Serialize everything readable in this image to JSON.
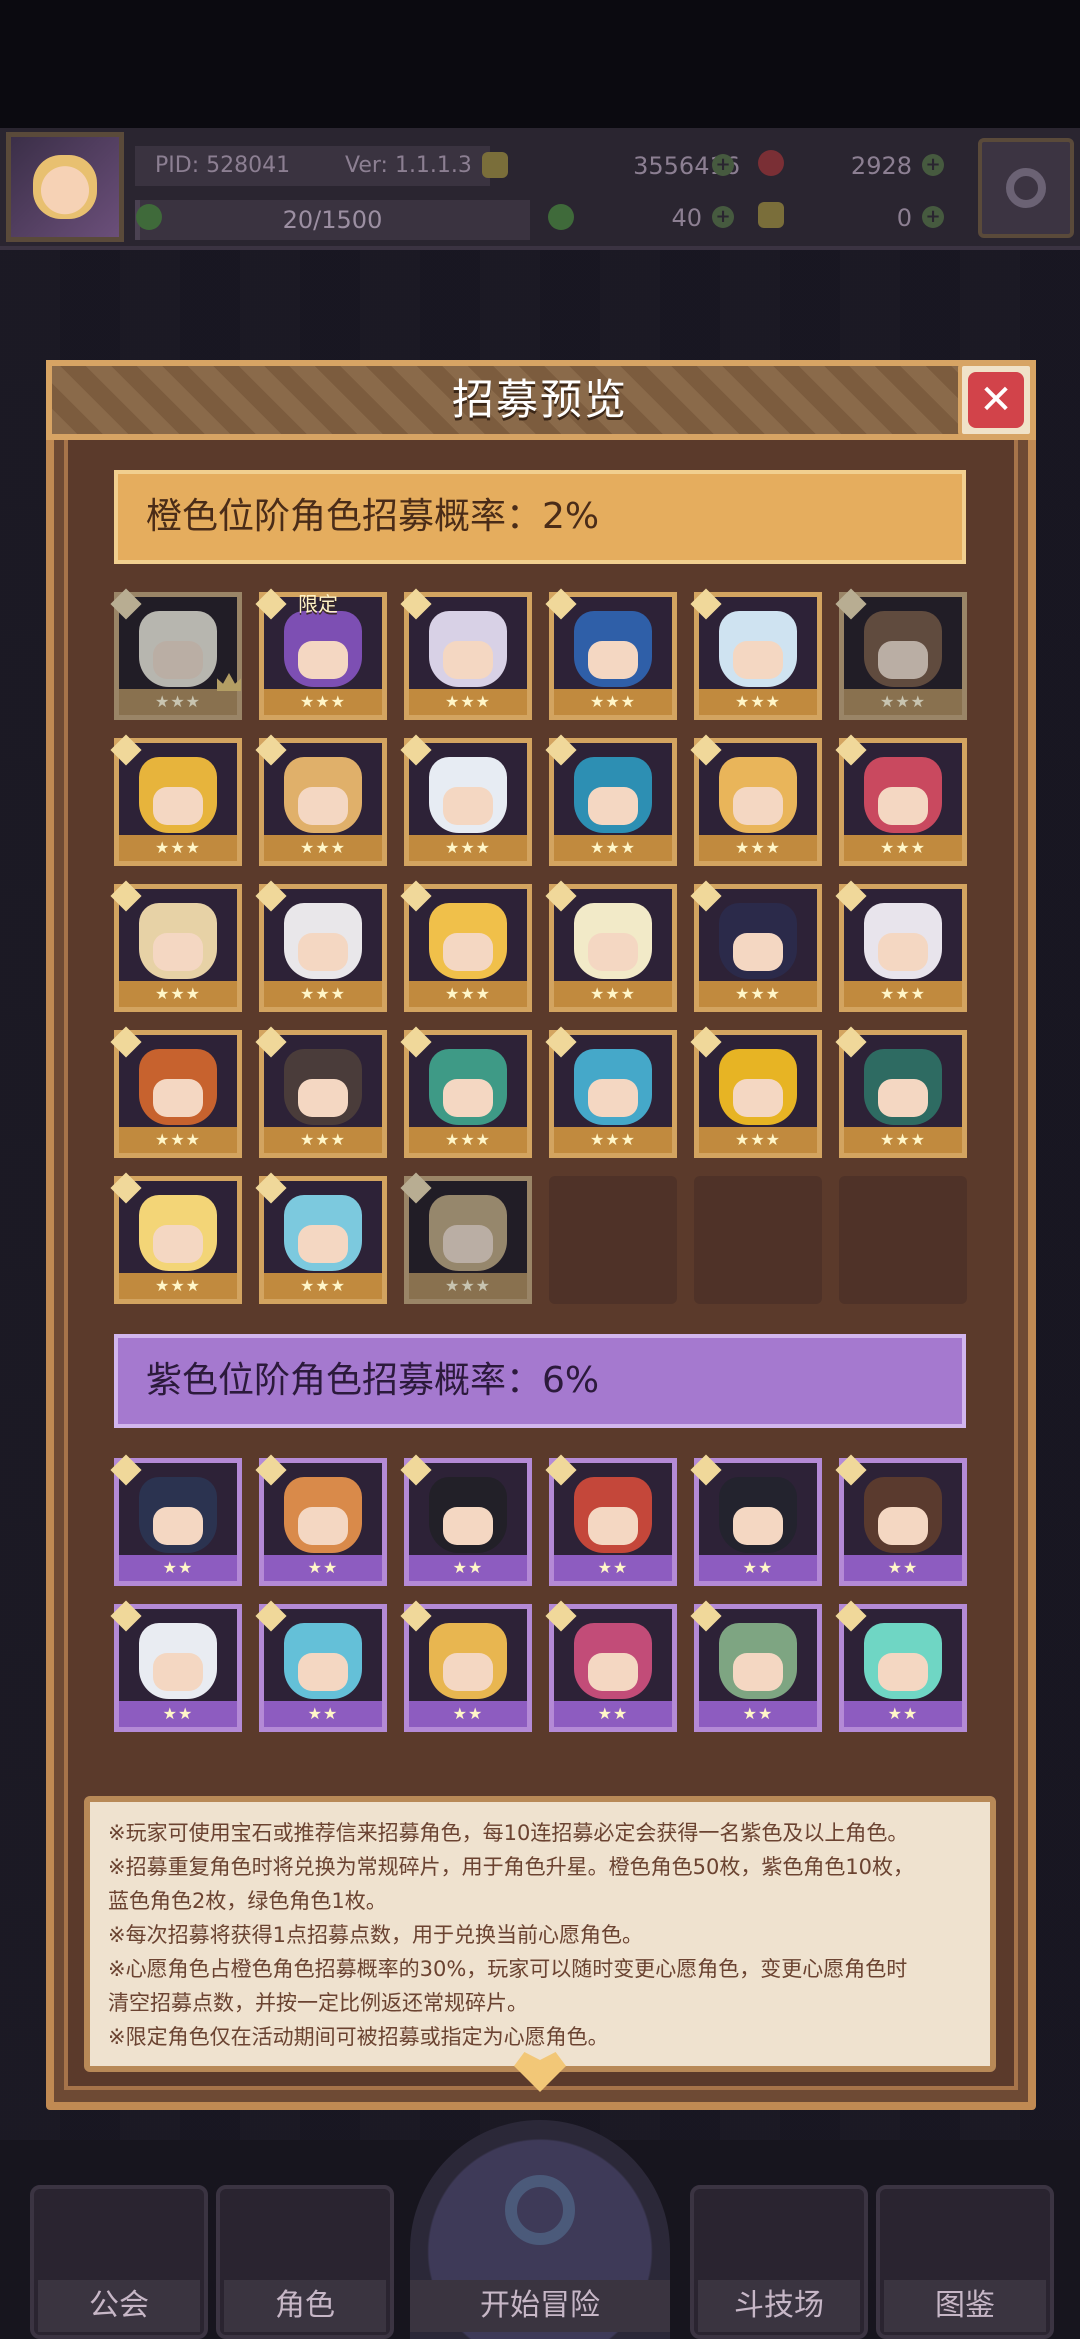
{
  "header": {
    "pid": "PID: 528041",
    "version": "Ver: 1.1.1.3",
    "xp": "20/1500",
    "xp_fraction": 0.0133,
    "gold": "3556416",
    "gems": "2928",
    "clover": "40",
    "music": "0"
  },
  "dialog": {
    "title": "招募预览",
    "orange_tier_label": "橙色位阶角色招募概率：2%",
    "purple_tier_label": "紫色位阶角色招募概率：6%",
    "limited_tag": "限定",
    "info_lines": [
      "※玩家可使用宝石或推荐信来招募角色，每10连招募必定会获得一名紫色及以上角色。",
      "※招募重复角色时将兑换为常规碎片，用于角色升星。橙色角色50枚，紫色角色10枚，",
      "蓝色角色2枚，绿色角色1枚。",
      "※每次招募将获得1点招募点数，用于兑换当前心愿角色。",
      "※心愿角色占橙色角色招募概率的30%，玩家可以随时变更心愿角色，变更心愿角色时",
      "清空招募点数，并按一定比例返还常规碎片。",
      "※限定角色仅在活动期间可被招募或指定为心愿角色。"
    ],
    "orange_stars": "★★★",
    "purple_stars": "★★"
  },
  "colors": {
    "orange_tier": "#e5ad5e",
    "purple_tier": "#a579cf",
    "panel": "#6e4a34",
    "close_red": "#d2434a"
  },
  "nav": {
    "guild": "公会",
    "characters": "角色",
    "start_adventure": "开始冒险",
    "arena": "斗技场",
    "codex": "图鉴"
  },
  "icons": [
    "gold-coin-icon",
    "red-gem-icon",
    "clover-icon",
    "music-note-icon",
    "gear-icon",
    "close-icon",
    "crown-icon",
    "heart-icon",
    "magnifier-icon",
    "crossed-swords-icon"
  ]
}
